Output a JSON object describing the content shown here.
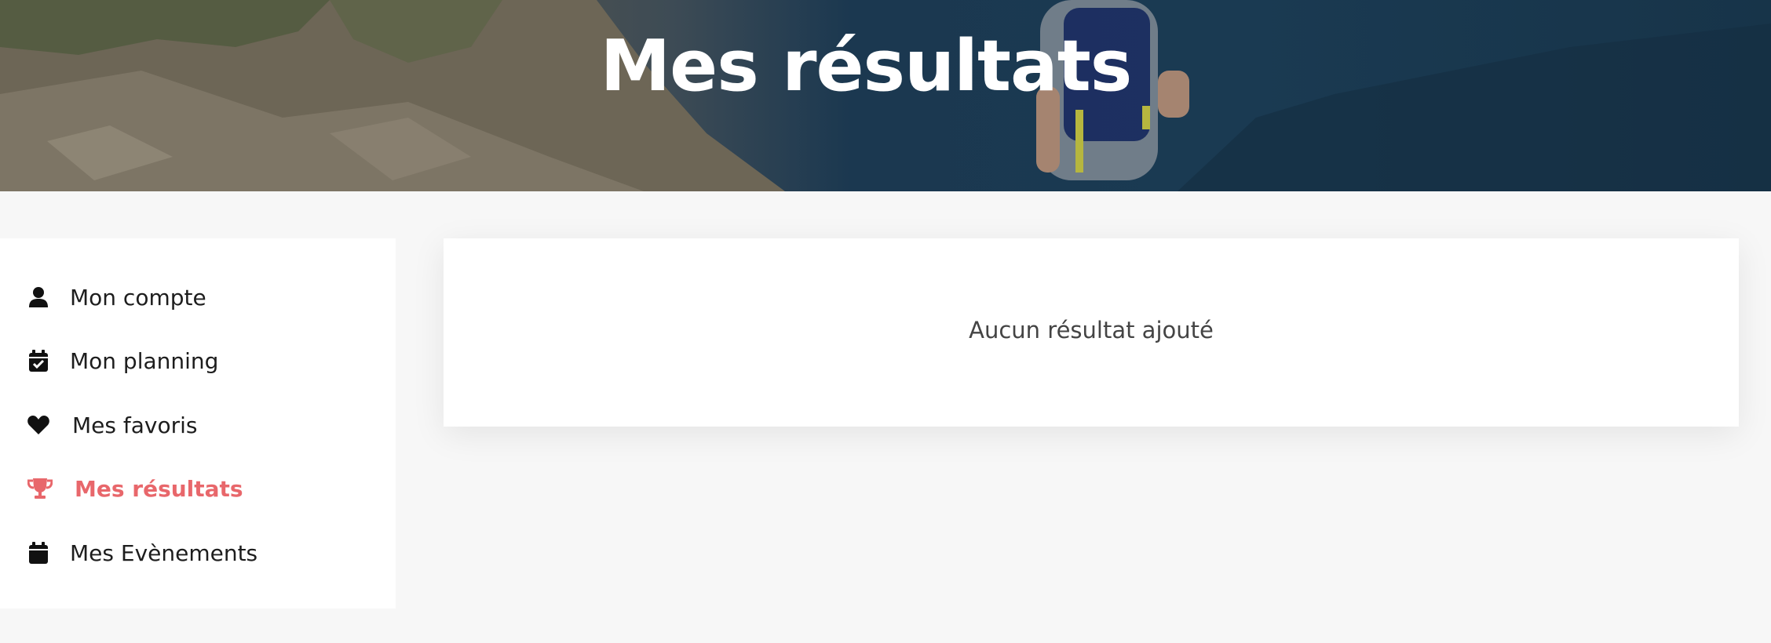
{
  "hero": {
    "title": "Mes résultats"
  },
  "sidebar": {
    "items": [
      {
        "label": "Mon compte",
        "icon": "user-icon",
        "active": false
      },
      {
        "label": "Mon planning",
        "icon": "calendar-check-icon",
        "active": false
      },
      {
        "label": "Mes favoris",
        "icon": "heart-icon",
        "active": false
      },
      {
        "label": "Mes résultats",
        "icon": "trophy-icon",
        "active": true
      },
      {
        "label": "Mes Evènements",
        "icon": "calendar-icon",
        "active": false
      }
    ]
  },
  "main": {
    "empty_message": "Aucun résultat ajouté"
  },
  "colors": {
    "accent": "#e8676b",
    "text": "#1d1d1d",
    "page_background": "#f7f7f7"
  }
}
